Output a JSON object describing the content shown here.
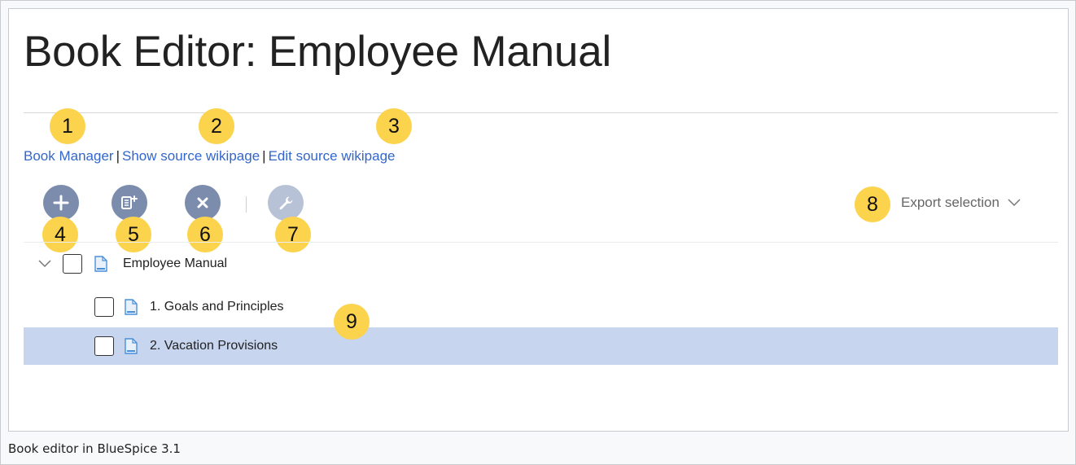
{
  "page": {
    "title": "Book Editor: Employee Manual"
  },
  "links": {
    "book_manager": "Book Manager",
    "separator": "|",
    "show_source": "Show source wikipage",
    "edit_source": "Edit source wikipage"
  },
  "toolbar": {
    "buttons": [
      {
        "name": "add-node",
        "icon": "plus-icon",
        "enabled": true
      },
      {
        "name": "add-mass-nodes",
        "icon": "add-list-icon",
        "enabled": true
      },
      {
        "name": "remove-node",
        "icon": "close-icon",
        "enabled": true
      },
      {
        "name": "node-settings",
        "icon": "wrench-icon",
        "enabled": false
      }
    ],
    "export_label": "Export selection",
    "export_icon": "chevron-down-icon"
  },
  "tree": {
    "nodes": [
      {
        "label": "Employee Manual",
        "level": 0,
        "expanded": true,
        "checked": false,
        "selected": false,
        "icon": "page-icon"
      },
      {
        "label": "1. Goals and Principles",
        "level": 1,
        "checked": false,
        "selected": false,
        "icon": "page-icon"
      },
      {
        "label": "2. Vacation Provisions",
        "level": 1,
        "checked": false,
        "selected": true,
        "icon": "page-icon"
      }
    ]
  },
  "callouts": [
    "1",
    "2",
    "3",
    "4",
    "5",
    "6",
    "7",
    "8",
    "9"
  ],
  "caption": "Book editor in BlueSpice 3.1",
  "colors": {
    "link": "#3366cc",
    "callout": "#fcd34d",
    "toolbar_button": "#7b8cad",
    "toolbar_button_disabled": "#b8c2d6",
    "selected_row": "#c7d5ef",
    "page_icon": "#4a90d9"
  }
}
